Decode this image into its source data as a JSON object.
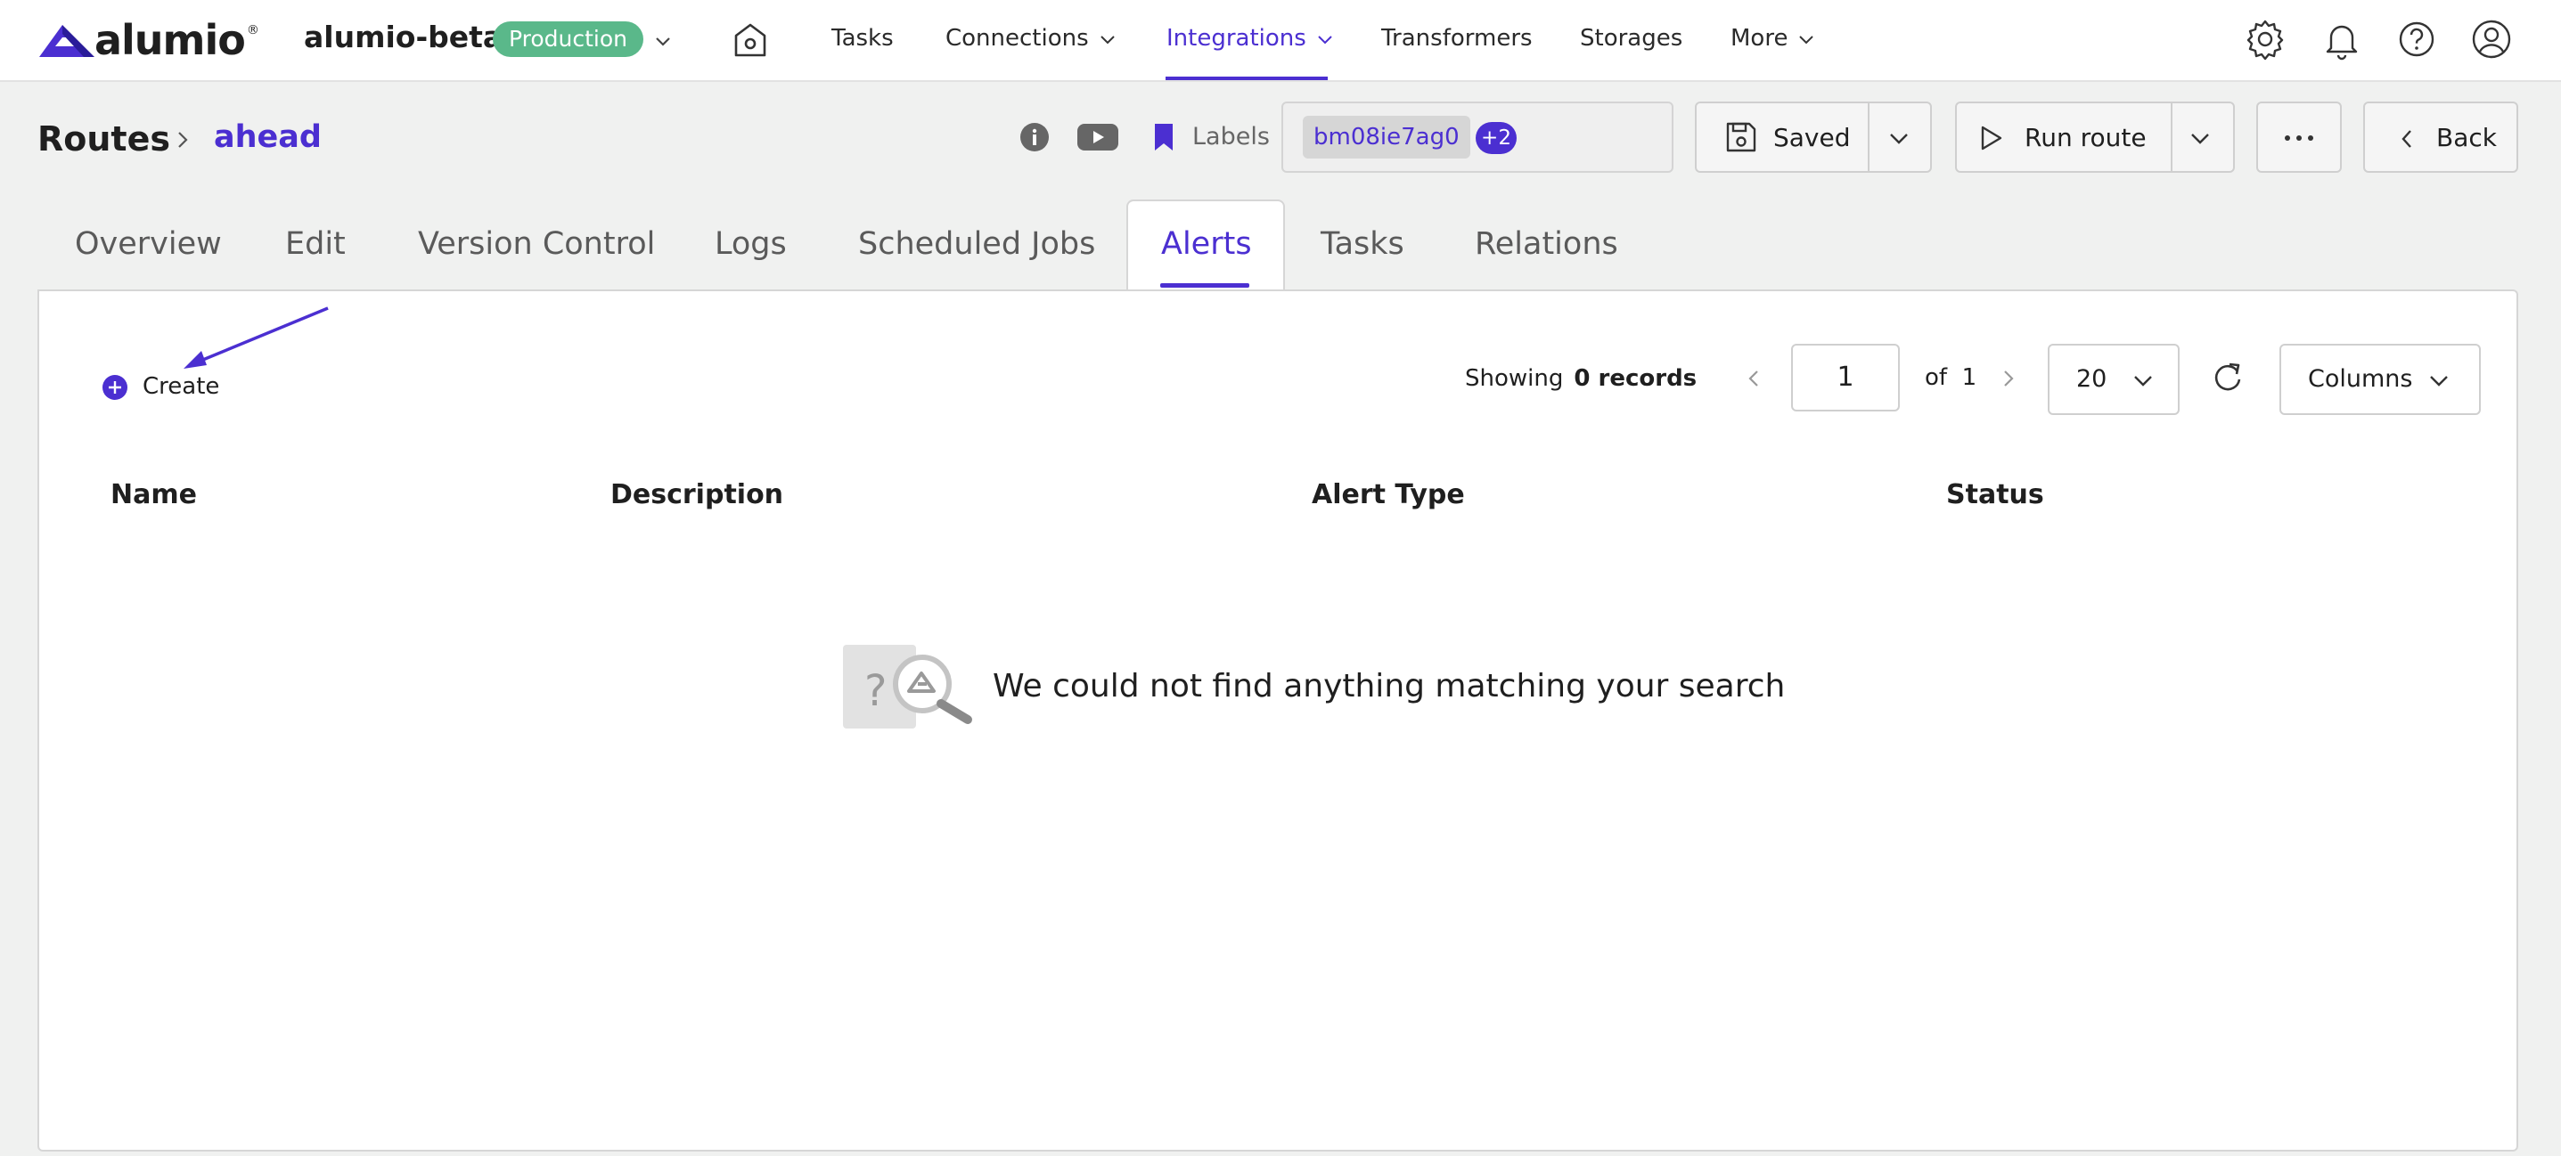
{
  "app": {
    "brand": "alumio",
    "env_name": "alumio-beta",
    "env_badge": "Production"
  },
  "nav": {
    "items": [
      {
        "label": "Tasks"
      },
      {
        "label": "Connections"
      },
      {
        "label": "Integrations"
      },
      {
        "label": "Transformers"
      },
      {
        "label": "Storages"
      },
      {
        "label": "More"
      }
    ],
    "active": "Integrations"
  },
  "breadcrumb": {
    "root": "Routes",
    "current": "ahead"
  },
  "header": {
    "labels_text": "Labels",
    "label_chip": "bm08ie7ag0",
    "label_more": "+2",
    "saved_label": "Saved",
    "run_label": "Run route",
    "more_label": "···",
    "back_label": "Back"
  },
  "tabs": [
    {
      "label": "Overview"
    },
    {
      "label": "Edit"
    },
    {
      "label": "Version Control"
    },
    {
      "label": "Logs"
    },
    {
      "label": "Scheduled Jobs"
    },
    {
      "label": "Alerts"
    },
    {
      "label": "Tasks"
    },
    {
      "label": "Relations"
    }
  ],
  "active_tab": "Alerts",
  "toolbar": {
    "create_label": "Create",
    "showing_label": "Showing",
    "records_label": "0 records",
    "page_value": "1",
    "of_label": "of",
    "total_pages": "1",
    "per_page": "20",
    "columns_label": "Columns"
  },
  "table": {
    "columns": [
      "Name",
      "Description",
      "Alert Type",
      "Status"
    ],
    "rows": []
  },
  "empty_state": {
    "message": "We could not find anything matching your search"
  },
  "colors": {
    "accent": "#4b2fd1",
    "badge_green": "#5ab88a",
    "background": "#f0f1f0"
  }
}
